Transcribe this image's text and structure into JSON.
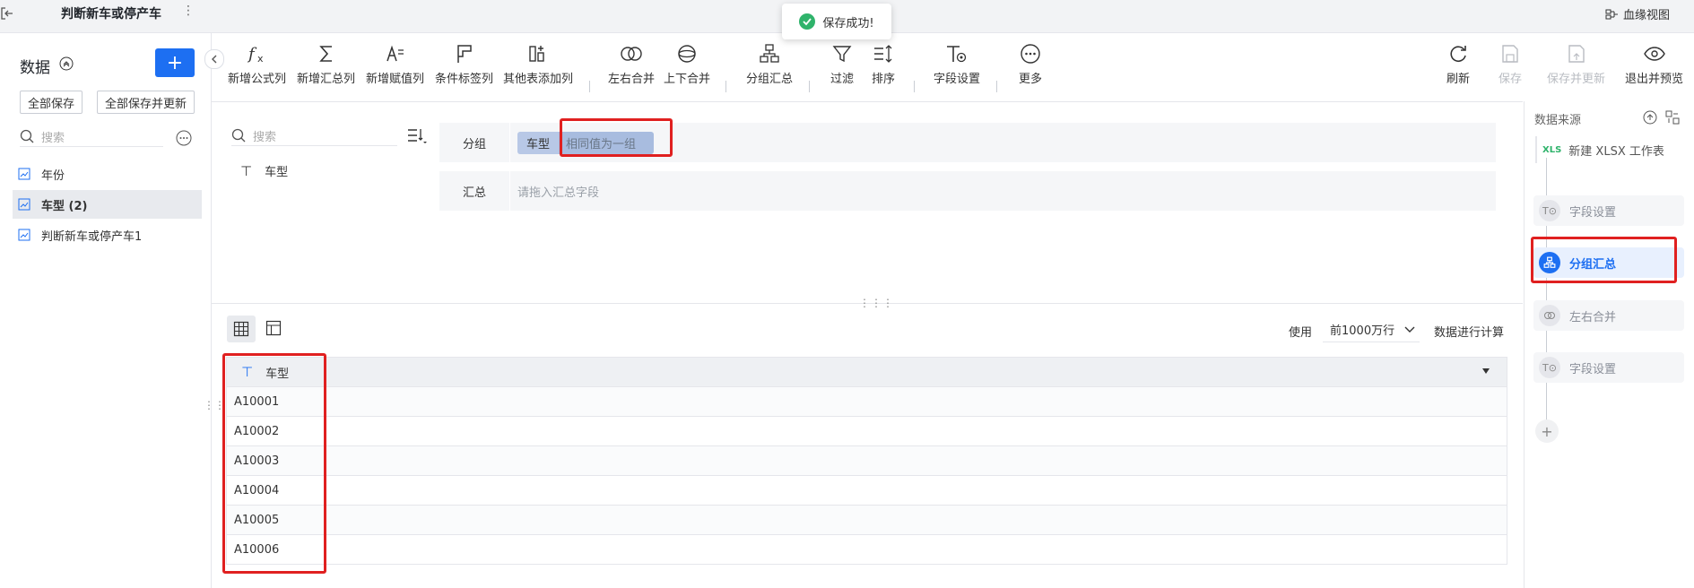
{
  "header": {
    "title": "判断新车或停产车",
    "more_label": "⋮",
    "lineage_label": "血缘视图"
  },
  "toast": {
    "message": "保存成功!"
  },
  "left": {
    "title": "数据",
    "add_label": "+",
    "save_all": "全部保存",
    "save_all_update": "全部保存并更新",
    "search_placeholder": "搜索",
    "items": [
      {
        "label": "年份",
        "selected": false
      },
      {
        "label": "车型 (2)",
        "selected": true
      },
      {
        "label": "判断新车或停产车1",
        "selected": false
      }
    ]
  },
  "toolbar": {
    "items": [
      {
        "label": "新增公式列",
        "icon": "formula-icon"
      },
      {
        "label": "新增汇总列",
        "icon": "sigma-icon"
      },
      {
        "label": "新增赋值列",
        "icon": "assign-icon"
      },
      {
        "label": "条件标签列",
        "icon": "flag-icon"
      },
      {
        "label": "其他表添加列",
        "icon": "add-column-icon"
      },
      {
        "label": "左右合并",
        "icon": "left-right-merge-icon"
      },
      {
        "label": "上下合并",
        "icon": "up-down-merge-icon"
      },
      {
        "label": "分组汇总",
        "icon": "group-summary-icon"
      },
      {
        "label": "过滤",
        "icon": "filter-icon"
      },
      {
        "label": "排序",
        "icon": "sort-icon"
      },
      {
        "label": "字段设置",
        "icon": "field-settings-icon"
      },
      {
        "label": "更多",
        "icon": "more-icon"
      }
    ],
    "refresh": "刷新",
    "save": "保存",
    "save_update": "保存并更新",
    "exit_preview": "退出并预览"
  },
  "config": {
    "search_placeholder": "搜索",
    "field_name": "车型",
    "group_label": "分组",
    "group_chip_field": "车型",
    "group_chip_value": "相同值为一组",
    "summary_label": "汇总",
    "summary_placeholder": "请拖入汇总字段"
  },
  "preview": {
    "use_label": "使用",
    "rows_option": "前1000万行",
    "calc_label": "数据进行计算",
    "column_header": "车型",
    "rows": [
      "A10001",
      "A10002",
      "A10003",
      "A10004",
      "A10005",
      "A10006"
    ]
  },
  "right": {
    "title": "数据来源",
    "source": "新建 XLSX 工作表",
    "source_icon_text": "XLS",
    "steps": [
      {
        "label": "字段设置",
        "active": false
      },
      {
        "label": "分组汇总",
        "active": true
      },
      {
        "label": "左右合并",
        "active": false
      },
      {
        "label": "字段设置",
        "active": false
      }
    ],
    "add_label": "+"
  },
  "colors": {
    "accent": "#1d6ff2",
    "highlight": "#e02020",
    "success": "#2fb36b"
  }
}
